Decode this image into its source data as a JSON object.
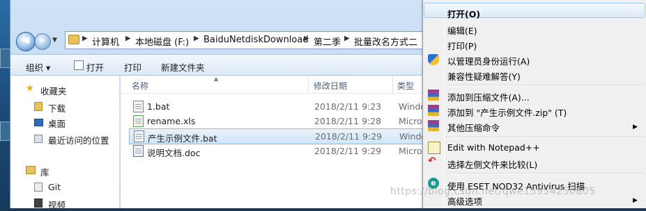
{
  "address_bar": {
    "crumbs": [
      "计算机",
      "本地磁盘 (F:)",
      "BaiduNetdiskDownload",
      "第二季",
      "批量改名方式二"
    ]
  },
  "toolbar": {
    "organize": "组织 ▾",
    "open": "打开",
    "print": "打印",
    "new_folder": "新建文件夹"
  },
  "nav": {
    "favorites": "收藏夹",
    "downloads": "下载",
    "desktop": "桌面",
    "recent": "最近访问的位置",
    "libraries": "库",
    "git": "Git",
    "videos": "视频"
  },
  "columns": {
    "name": "名称",
    "date": "修改日期",
    "type": "类型"
  },
  "files": [
    {
      "name": "1.bat",
      "date": "2018/2/11 9:23",
      "type": "Windo",
      "icon": "bat-file-icon"
    },
    {
      "name": "rename.xls",
      "date": "2018/2/11 9:28",
      "type": "Micros",
      "icon": "excel-file-icon"
    },
    {
      "name": "产生示例文件.bat",
      "date": "2018/2/11 9:29",
      "type": "Windo",
      "icon": "bat-file-icon"
    },
    {
      "name": "说明文档.doc",
      "date": "2018/2/11 9:29",
      "type": "Micros",
      "icon": "word-file-icon"
    }
  ],
  "context_menu": {
    "open": "打开(O)",
    "edit": "编辑(E)",
    "print": "打印(P)",
    "run_as_admin": "以管理员身份运行(A)",
    "compat": "兼容性疑难解答(Y)",
    "add_archive": "添加到压缩文件(A)...",
    "add_zip": "添加到 \"产生示例文件.zip\" (T)",
    "other_compress": "其他压缩命令",
    "edit_notepad": "Edit with Notepad++",
    "compare_left": "选择左侧文件来比较(L)",
    "eset_scan": "使用 ESET NOD32 Antivirus 扫描",
    "advanced": "高级选项"
  },
  "watermark": "https://blog.csdn.net/qwe15954250805",
  "colors": {
    "selection": "#cfe6fa",
    "menu_bg": "#f0f0f0",
    "toolbar_bg": "#dce8f5"
  }
}
